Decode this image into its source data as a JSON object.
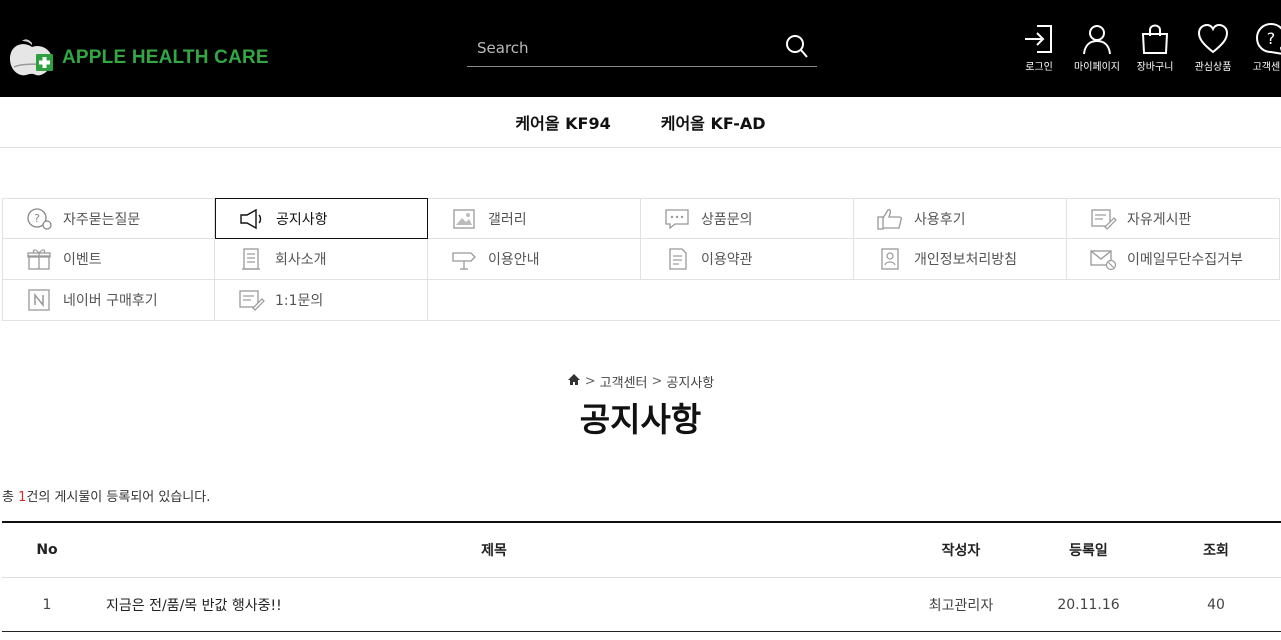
{
  "header": {
    "logo_text": "APPLE HEALTH CARE",
    "search_placeholder": "Search",
    "icons": [
      {
        "label": "로그인",
        "icon": "login-icon"
      },
      {
        "label": "마이페이지",
        "icon": "user-icon"
      },
      {
        "label": "장바구니",
        "icon": "cart-bag-icon"
      },
      {
        "label": "관심상품",
        "icon": "heart-icon"
      },
      {
        "label": "고객센터",
        "icon": "help-icon"
      }
    ]
  },
  "category_nav": [
    {
      "label": "케어올 KF94"
    },
    {
      "label": "케어올 KF-AD"
    }
  ],
  "board_menu": [
    {
      "label": "자주묻는질문",
      "icon": "faq-icon"
    },
    {
      "label": "공지사항",
      "icon": "megaphone-icon",
      "active": true
    },
    {
      "label": "갤러리",
      "icon": "gallery-icon"
    },
    {
      "label": "상품문의",
      "icon": "chat-icon"
    },
    {
      "label": "사용후기",
      "icon": "thumbs-up-icon"
    },
    {
      "label": "자유게시판",
      "icon": "board-icon"
    },
    {
      "label": "이벤트",
      "icon": "gift-icon"
    },
    {
      "label": "회사소개",
      "icon": "building-icon"
    },
    {
      "label": "이용안내",
      "icon": "signpost-icon"
    },
    {
      "label": "이용약관",
      "icon": "document-icon"
    },
    {
      "label": "개인정보처리방침",
      "icon": "privacy-icon"
    },
    {
      "label": "이메일무단수집거부",
      "icon": "mail-block-icon"
    },
    {
      "label": "네이버 구매후기",
      "icon": "naver-icon"
    },
    {
      "label": "1:1문의",
      "icon": "inquiry-icon"
    }
  ],
  "breadcrumb": {
    "items": [
      "고객센터",
      "공지사항"
    ],
    "separator": ">"
  },
  "page_title": "공지사항",
  "count_text": {
    "prefix": "총 ",
    "count": "1",
    "suffix": "건의 게시물이 등록되어 있습니다."
  },
  "table": {
    "headers": {
      "no": "No",
      "title": "제목",
      "author": "작성자",
      "date": "등록일",
      "hits": "조회"
    },
    "rows": [
      {
        "no": "1",
        "title": "지금은 전/품/목 반값 행사중!!",
        "author": "최고관리자",
        "date": "20.11.16",
        "hits": "40"
      }
    ]
  },
  "colors": {
    "header_bg": "#000000",
    "logo_green": "#32a844",
    "count_red": "#d32f2f"
  }
}
